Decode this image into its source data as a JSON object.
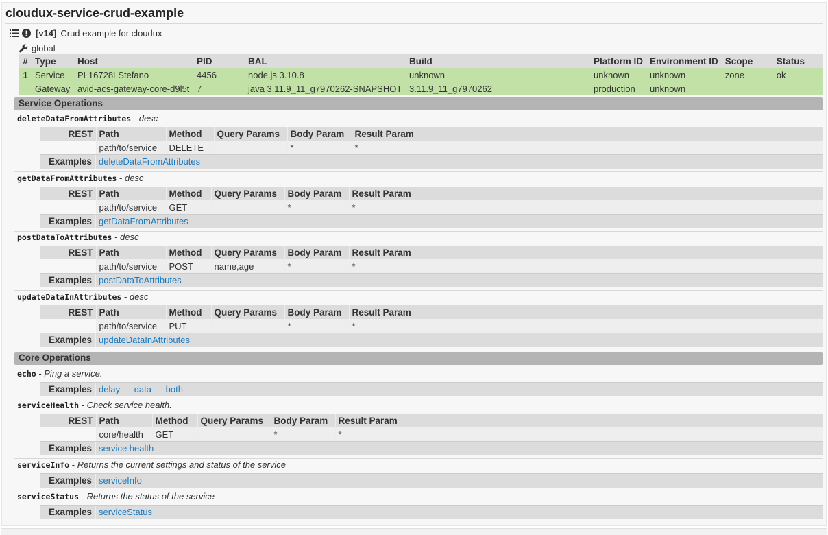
{
  "title": "cloudux-service-crud-example",
  "service": {
    "version": "[v14]",
    "description": "Crud example for cloudux"
  },
  "global_label": "global",
  "instances": {
    "headers": [
      "#",
      "Type",
      "Host",
      "PID",
      "BAL",
      "Build",
      "Platform ID",
      "Environment ID",
      "Scope",
      "Status"
    ],
    "rows": [
      [
        "1",
        "Service",
        "PL16728LStefano",
        "4456",
        "node.js 3.10.8",
        "unknown",
        "unknown",
        "unknown",
        "zone",
        "ok"
      ],
      [
        "",
        "Gateway",
        "avid-acs-gateway-core-d9l5t",
        "7",
        "java 3.11.9_11_g7970262-SNAPSHOT",
        "3.11.9_11_g7970262",
        "production",
        "unknown",
        "",
        ""
      ]
    ]
  },
  "rest_headers": {
    "rest": "REST",
    "path": "Path",
    "method": "Method",
    "query": "Query Params",
    "body": "Body Param",
    "result": "Result Param"
  },
  "examples_label": "Examples",
  "sections": {
    "service_operations": "Service Operations",
    "core_operations": "Core Operations"
  },
  "service_ops": [
    {
      "name": "deleteDataFromAttributes",
      "desc": "desc",
      "path": "path/to/service",
      "method": "DELETE",
      "query": "",
      "body": "*",
      "result": "*",
      "examples": [
        "deleteDataFromAttributes"
      ]
    },
    {
      "name": "getDataFromAttributes",
      "desc": "desc",
      "path": "path/to/service",
      "method": "GET",
      "query": "",
      "body": "*",
      "result": "*",
      "examples": [
        "getDataFromAttributes"
      ]
    },
    {
      "name": "postDataToAttributes",
      "desc": "desc",
      "path": "path/to/service",
      "method": "POST",
      "query": "name,age",
      "body": "*",
      "result": "*",
      "examples": [
        "postDataToAttributes"
      ]
    },
    {
      "name": "updateDataInAttributes",
      "desc": "desc",
      "path": "path/to/service",
      "method": "PUT",
      "query": "",
      "body": "*",
      "result": "*",
      "examples": [
        "updateDataInAttributes"
      ]
    }
  ],
  "core_ops": {
    "echo": {
      "name": "echo",
      "desc": "Ping a service.",
      "examples": [
        "delay",
        "data",
        "both"
      ]
    },
    "serviceHealth": {
      "name": "serviceHealth",
      "desc": "Check service health.",
      "path": "core/health",
      "method": "GET",
      "query": "",
      "body": "*",
      "result": "*",
      "examples": [
        "service health"
      ]
    },
    "serviceInfo": {
      "name": "serviceInfo",
      "desc": "Returns the current settings and status of the service",
      "examples": [
        "serviceInfo"
      ]
    },
    "serviceStatus": {
      "name": "serviceStatus",
      "desc": "Returns the status of the service",
      "examples": [
        "serviceStatus"
      ]
    }
  },
  "colors": {
    "instance_row": "#c2e1a7",
    "section_bar": "#b4b4b4",
    "link": "#1a7bc1"
  },
  "icons": [
    "list-icon",
    "alert-circle-icon",
    "wrench-icon"
  ]
}
